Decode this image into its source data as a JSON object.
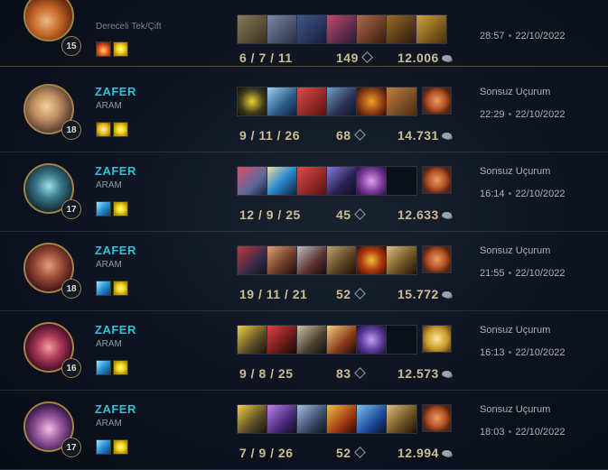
{
  "matches": [
    {
      "champion_icon": "teemo-icon",
      "level": "15",
      "result": "",
      "queue": "Dereceli Tek/Çift",
      "spells": [
        "ignite-icon",
        "flash-icon"
      ],
      "items": [
        "item-1",
        "item-2",
        "item-3",
        "item-4",
        "item-5",
        "item-6",
        "item-7"
      ],
      "trinket": "",
      "kda": "6 / 7 / 11",
      "cs": "149",
      "gold": "12.006",
      "map": "",
      "duration": "28:57",
      "date": "22/10/2022",
      "accent": "#d3903a"
    },
    {
      "champion_icon": "ezreal-icon",
      "level": "18",
      "result": "ZAFER",
      "queue": "ARAM",
      "spells": [
        "cleanse-icon",
        "flash-icon"
      ],
      "items": [
        "item-1",
        "item-2",
        "item-3",
        "item-4",
        "item-5",
        "item-6"
      ],
      "trinket": "poro-snax-icon",
      "kda": "9 / 11 / 26",
      "cs": "68",
      "gold": "14.731",
      "map": "Sonsuz Uçurum",
      "duration": "22:29",
      "date": "22/10/2022",
      "accent": "#d6b070"
    },
    {
      "champion_icon": "kalista-icon",
      "level": "17",
      "result": "ZAFER",
      "queue": "ARAM",
      "spells": [
        "ghost-icon",
        "flash-icon"
      ],
      "items": [
        "item-1",
        "item-2",
        "item-3",
        "item-4",
        "item-5",
        ""
      ],
      "trinket": "poro-snax-icon",
      "kda": "12 / 9 / 25",
      "cs": "45",
      "gold": "12.633",
      "map": "Sonsuz Uçurum",
      "duration": "16:14",
      "date": "22/10/2022",
      "accent": "#3a8c9a"
    },
    {
      "champion_icon": "darius-icon",
      "level": "18",
      "result": "ZAFER",
      "queue": "ARAM",
      "spells": [
        "ghost-icon",
        "flash-icon"
      ],
      "items": [
        "item-1",
        "item-2",
        "item-3",
        "item-4",
        "item-5",
        "item-6"
      ],
      "trinket": "poro-snax-icon",
      "kda": "19 / 11 / 21",
      "cs": "52",
      "gold": "15.772",
      "map": "Sonsuz Uçurum",
      "duration": "21:55",
      "date": "22/10/2022",
      "accent": "#a8342a"
    },
    {
      "champion_icon": "xayah-icon",
      "level": "16",
      "result": "ZAFER",
      "queue": "ARAM",
      "spells": [
        "ghost-icon",
        "flash-icon"
      ],
      "items": [
        "item-1",
        "item-2",
        "item-3",
        "item-4",
        "item-5",
        ""
      ],
      "trinket": "ward-icon",
      "kda": "9 / 8 / 25",
      "cs": "83",
      "gold": "12.573",
      "map": "Sonsuz Uçurum",
      "duration": "16:13",
      "date": "22/10/2022",
      "accent": "#a02a44"
    },
    {
      "champion_icon": "neeko-icon",
      "level": "17",
      "result": "ZAFER",
      "queue": "ARAM",
      "spells": [
        "ghost-icon",
        "flash-icon"
      ],
      "items": [
        "item-1",
        "item-2",
        "item-3",
        "item-4",
        "item-5",
        "item-6"
      ],
      "trinket": "poro-snax-icon",
      "kda": "7 / 9 / 26",
      "cs": "52",
      "gold": "12.994",
      "map": "Sonsuz Uçurum",
      "duration": "18:03",
      "date": "22/10/2022",
      "accent": "#7a4a8a"
    }
  ],
  "colors": {
    "victory": "#29c5d6",
    "text_gold": "#cdbe91",
    "frame_gold": "#a08445"
  }
}
